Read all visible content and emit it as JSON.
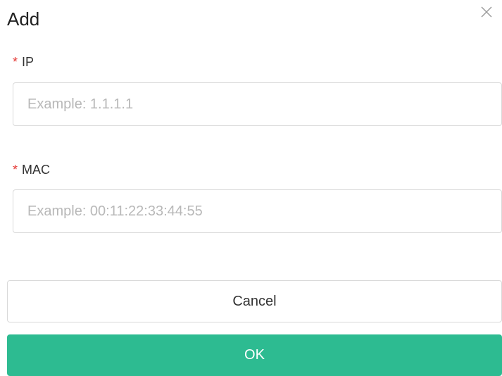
{
  "dialog": {
    "title": "Add",
    "close_icon": "close-icon"
  },
  "fields": {
    "ip": {
      "required_mark": "*",
      "label": "IP",
      "placeholder": "Example: 1.1.1.1",
      "value": ""
    },
    "mac": {
      "required_mark": "*",
      "label": "MAC",
      "placeholder": "Example: 00:11:22:33:44:55",
      "value": ""
    }
  },
  "actions": {
    "cancel_label": "Cancel",
    "ok_label": "OK"
  },
  "colors": {
    "accent": "#2dbb91",
    "required": "#e53935",
    "border": "#d9d9d9",
    "placeholder": "#b8b8b8"
  }
}
